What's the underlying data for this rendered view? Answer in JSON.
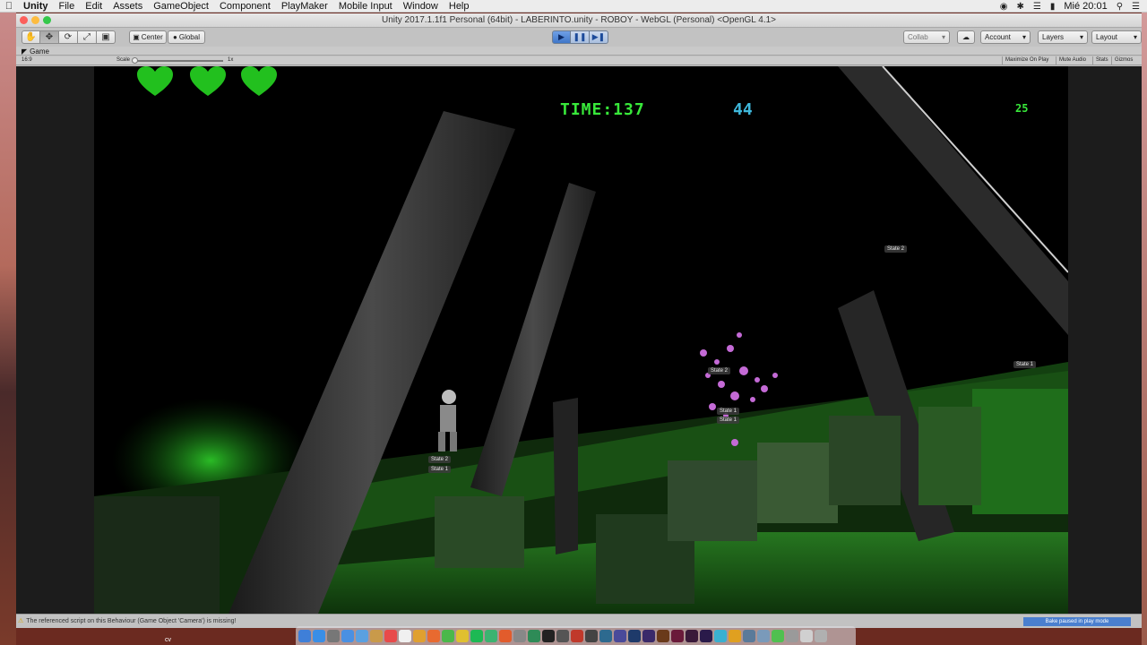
{
  "menubar": {
    "app": "Unity",
    "items": [
      "File",
      "Edit",
      "Assets",
      "GameObject",
      "Component",
      "PlayMaker",
      "Mobile Input",
      "Window",
      "Help"
    ],
    "clock": "Mié 20:01"
  },
  "window": {
    "title": "Unity 2017.1.1f1 Personal (64bit) - LABERINTO.unity - ROBOY - WebGL (Personal) <OpenGL 4.1>"
  },
  "toolbar": {
    "pivot_label": "Center",
    "space_label": "Global",
    "collab_label": "Collab",
    "account_label": "Account",
    "layers_label": "Layers",
    "layout_label": "Layout"
  },
  "game_view": {
    "tab_label": "Game",
    "aspect": "16:9",
    "scale_label": "Scale",
    "scale_value": "1x",
    "maximize_label": "Maximize On Play",
    "mute_label": "Mute Audio",
    "stats_label": "Stats",
    "gizmos_label": "Gizmos"
  },
  "hud": {
    "lives": 3,
    "time_text": "TIME:137",
    "count_text": "44",
    "score_text": "25",
    "heart_color": "#22c01e",
    "accent_green": "#38e83a",
    "accent_blue": "#3fb8dc"
  },
  "state_labels": {
    "s1": "State 2",
    "s2": "State 1",
    "s3": "State 2",
    "s4": "State 1",
    "s5": "State 1",
    "s6": "State 2",
    "s7": "State 1"
  },
  "status": {
    "warning": "The referenced script on this Behaviour (Game Object 'Camera') is missing!",
    "bake": "Bake paused in play mode"
  },
  "desktop": {
    "cv_label": "cv"
  }
}
